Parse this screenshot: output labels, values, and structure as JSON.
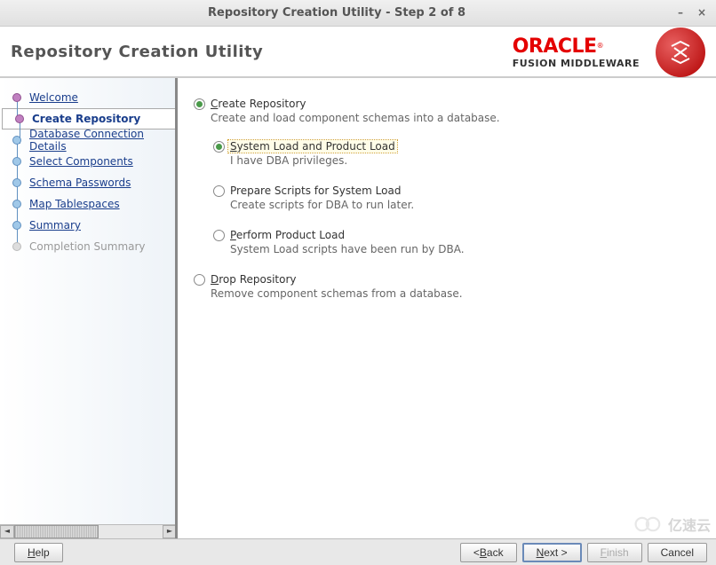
{
  "window": {
    "title": "Repository Creation Utility - Step 2 of 8"
  },
  "header": {
    "title": "Repository Creation Utility",
    "brand_main": "ORACLE",
    "brand_sub": "FUSION MIDDLEWARE"
  },
  "steps": [
    {
      "label": "Welcome",
      "state": "done"
    },
    {
      "label": "Create Repository",
      "state": "current"
    },
    {
      "label": "Database Connection Details",
      "state": "pending"
    },
    {
      "label": "Select Components",
      "state": "pending"
    },
    {
      "label": "Schema Passwords",
      "state": "pending"
    },
    {
      "label": "Map Tablespaces",
      "state": "pending"
    },
    {
      "label": "Summary",
      "state": "pending"
    },
    {
      "label": "Completion Summary",
      "state": "disabled"
    }
  ],
  "options": {
    "create": {
      "label_pre": "",
      "label_u": "C",
      "label_post": "reate Repository",
      "desc": "Create and load component schemas into a database.",
      "selected": true
    },
    "sub": [
      {
        "label_pre": "",
        "label_u": "S",
        "label_post": "ystem Load and Product Load",
        "desc": "I have DBA privileges.",
        "selected": true,
        "focused": true
      },
      {
        "label_pre": "Prepare Scripts for System Load",
        "label_u": "",
        "label_post": "",
        "desc": "Create scripts for DBA to run later.",
        "selected": false,
        "focused": false
      },
      {
        "label_pre": "",
        "label_u": "P",
        "label_post": "erform Product Load",
        "desc": "System Load scripts have been run by DBA.",
        "selected": false,
        "focused": false
      }
    ],
    "drop": {
      "label_pre": "",
      "label_u": "D",
      "label_post": "rop Repository",
      "desc": "Remove component schemas from a database.",
      "selected": false
    }
  },
  "buttons": {
    "help_u": "H",
    "help_post": "elp",
    "back_pre": "< ",
    "back_u": "B",
    "back_post": "ack",
    "next_u": "N",
    "next_post": "ext >",
    "finish_u": "F",
    "finish_post": "inish",
    "cancel": "Cancel"
  },
  "watermark": {
    "text": "亿速云"
  }
}
